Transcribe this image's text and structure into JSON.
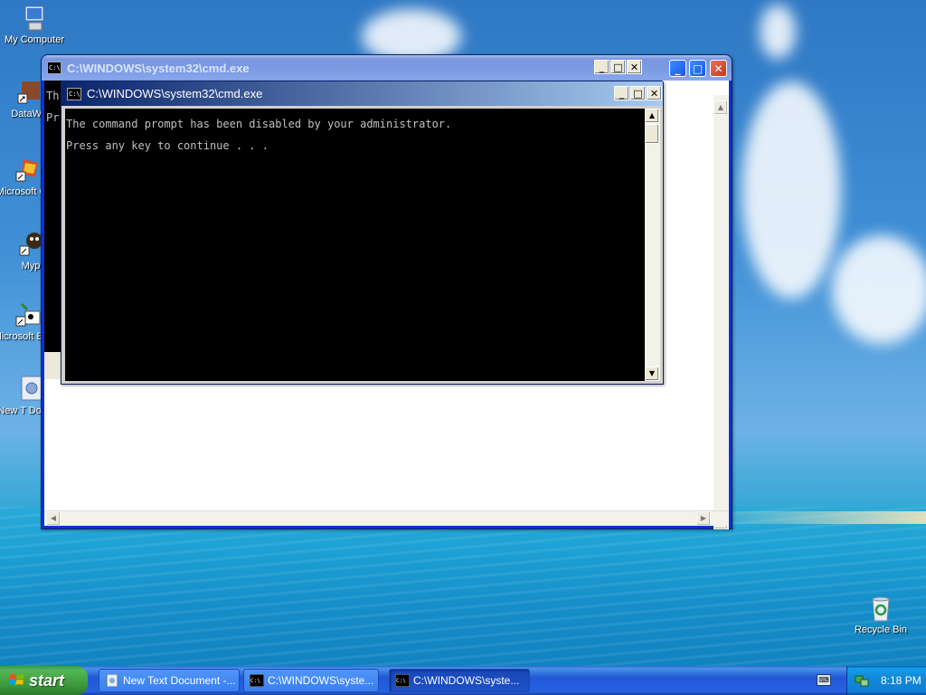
{
  "desktop": {
    "icons": [
      {
        "label": "My Computer"
      },
      {
        "label": "DataWa"
      },
      {
        "label": "Microsoft C++"
      },
      {
        "label": "Myp"
      },
      {
        "label": "Microsoft Basic"
      },
      {
        "label": "New T Docum"
      },
      {
        "label": "Recycle Bin"
      }
    ]
  },
  "back_window": {
    "title": "C:\\WINDOWS\\system32\\cmd.exe",
    "console_line1": "Th",
    "console_line2": "Pr"
  },
  "front_window": {
    "title": "C:\\WINDOWS\\system32\\cmd.exe",
    "console_lines": [
      "The command prompt has been disabled by your administrator.",
      "Press any key to continue . . ."
    ]
  },
  "taskbar": {
    "start_label": "start",
    "items": [
      {
        "label": "New Text Document -..."
      },
      {
        "label": "C:\\WINDOWS\\syste..."
      },
      {
        "label": "C:\\WINDOWS\\syste..."
      }
    ],
    "clock": "8:18 PM"
  },
  "icons": {
    "cmd": "console-icon",
    "minimize": "minimize-icon",
    "maximize": "maximize-icon",
    "close": "close-icon"
  }
}
